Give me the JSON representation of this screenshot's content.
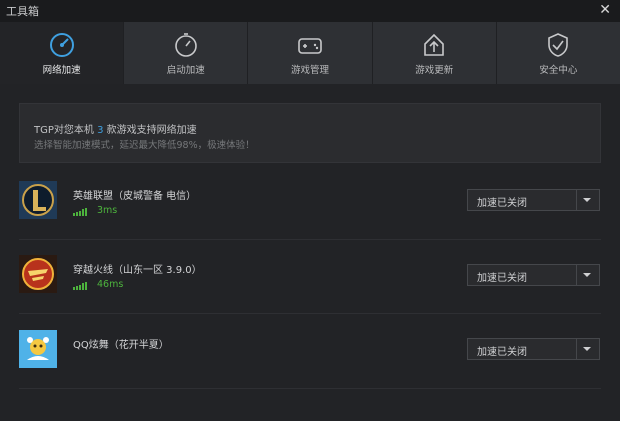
{
  "window": {
    "title": "工具箱",
    "close": "✕"
  },
  "tabs": [
    {
      "label": "网络加速",
      "icon": "speedometer-icon",
      "active": true
    },
    {
      "label": "启动加速",
      "icon": "stopwatch-icon"
    },
    {
      "label": "游戏管理",
      "icon": "gamepad-icon"
    },
    {
      "label": "游戏更新",
      "icon": "upload-update-icon"
    },
    {
      "label": "安全中心",
      "icon": "shield-check-icon"
    }
  ],
  "info": {
    "prefix": "TGP对您本机 ",
    "count": "3",
    "suffix": " 款游戏支持网络加速",
    "subtitle": "选择智能加速模式，延迟最大降低98%，极速体验！"
  },
  "games": [
    {
      "name": "英雄联盟（皮城警备 电信）",
      "ping": "3ms",
      "icon": "lol-logo-icon",
      "status": "加速已关闭"
    },
    {
      "name": "穿越火线（山东一区 3.9.0）",
      "ping": "46ms",
      "icon": "cf-logo-icon",
      "status": "加速已关闭"
    },
    {
      "name": "QQ炫舞（花开半夏）",
      "ping": "",
      "icon": "qq-dance-logo-icon",
      "status": "加速已关闭"
    }
  ],
  "colors": {
    "accent": "#3fa0e0",
    "ping_green": "#4db33d",
    "background": "#222326"
  }
}
